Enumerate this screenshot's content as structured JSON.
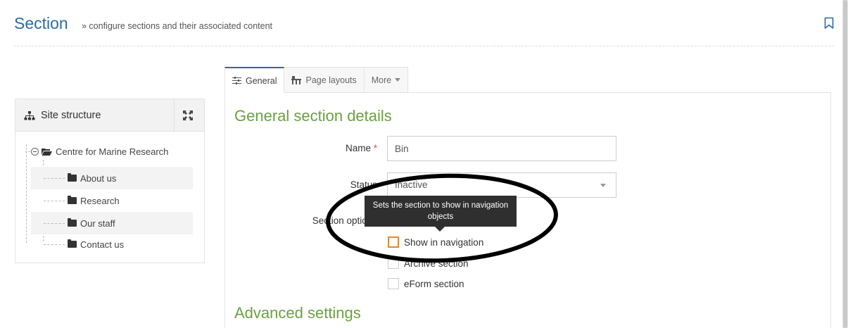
{
  "header": {
    "title": "Section",
    "subtitle": "» configure sections and their associated content"
  },
  "site_structure": {
    "title": "Site structure",
    "root": "Centre for Marine Research",
    "children": [
      "About us",
      "Research",
      "Our staff",
      "Contact us"
    ]
  },
  "tabs": [
    {
      "label": "General",
      "icon": "sliders-icon",
      "active": true
    },
    {
      "label": "Page layouts",
      "icon": "layout-icon",
      "active": false
    },
    {
      "label": "More",
      "icon": "caret-down-icon",
      "active": false
    }
  ],
  "form": {
    "section_title": "General section details",
    "name_label": "Name",
    "required_mark": "*",
    "name_value": "Bin",
    "status_label": "Status",
    "status_value": "Inactive",
    "options_label": "Section options",
    "tooltip": "Sets the section to show in navigation objects",
    "checkboxes": [
      "Show in navigation",
      "Archive section",
      "eForm section"
    ],
    "advanced_title": "Advanced settings"
  },
  "colors": {
    "title_blue": "#2c6aa5",
    "section_green": "#6aa13f",
    "focus_orange": "#e08a2e",
    "tooltip_bg": "#2f2f2f"
  }
}
